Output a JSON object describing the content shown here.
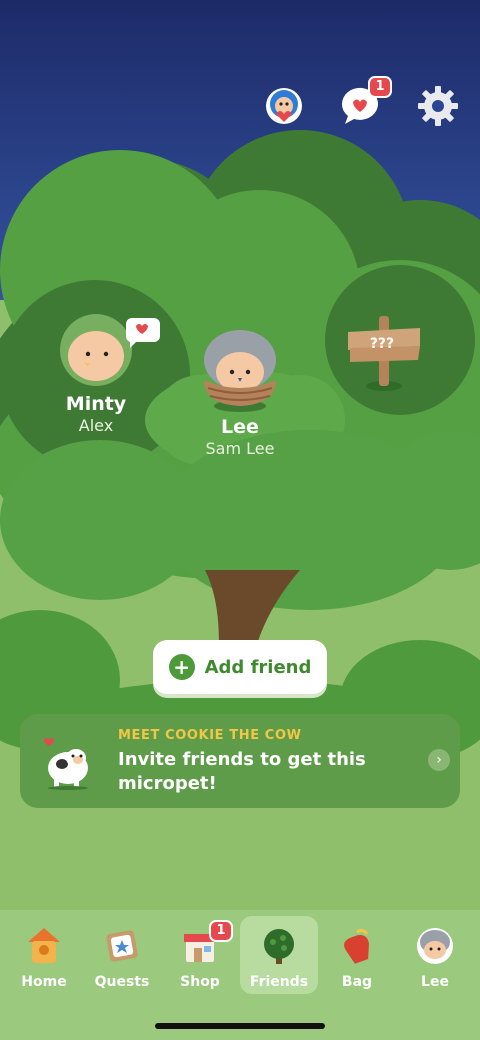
{
  "header": {
    "mail_badge": "1"
  },
  "friends": [
    {
      "pet": "Minty",
      "owner": "Alex"
    },
    {
      "pet": "Lee",
      "owner": "Sam Lee"
    }
  ],
  "signpost": {
    "label": "???"
  },
  "add_friend": {
    "label": "Add friend"
  },
  "promo": {
    "eyebrow": "MEET COOKIE THE COW",
    "message": "Invite friends to get this micropet!"
  },
  "tabs": {
    "items": [
      {
        "label": "Home",
        "icon": "birdhouse-icon"
      },
      {
        "label": "Quests",
        "icon": "quest-card-icon"
      },
      {
        "label": "Shop",
        "icon": "shop-icon",
        "badge": "1"
      },
      {
        "label": "Friends",
        "icon": "tree-icon",
        "active": true
      },
      {
        "label": "Bag",
        "icon": "bag-icon"
      },
      {
        "label": "Lee",
        "icon": "profile-pet-icon"
      }
    ]
  },
  "colors": {
    "sky_top": "#1f2f6e",
    "sky_bottom": "#2d4a9a",
    "leaf_dark": "#3f7a35",
    "leaf_mid": "#58a046",
    "leaf_light": "#6cb252",
    "ground": "#8fbf6a",
    "badge_red": "#e5484d",
    "accent_yellow": "#f2c744"
  }
}
